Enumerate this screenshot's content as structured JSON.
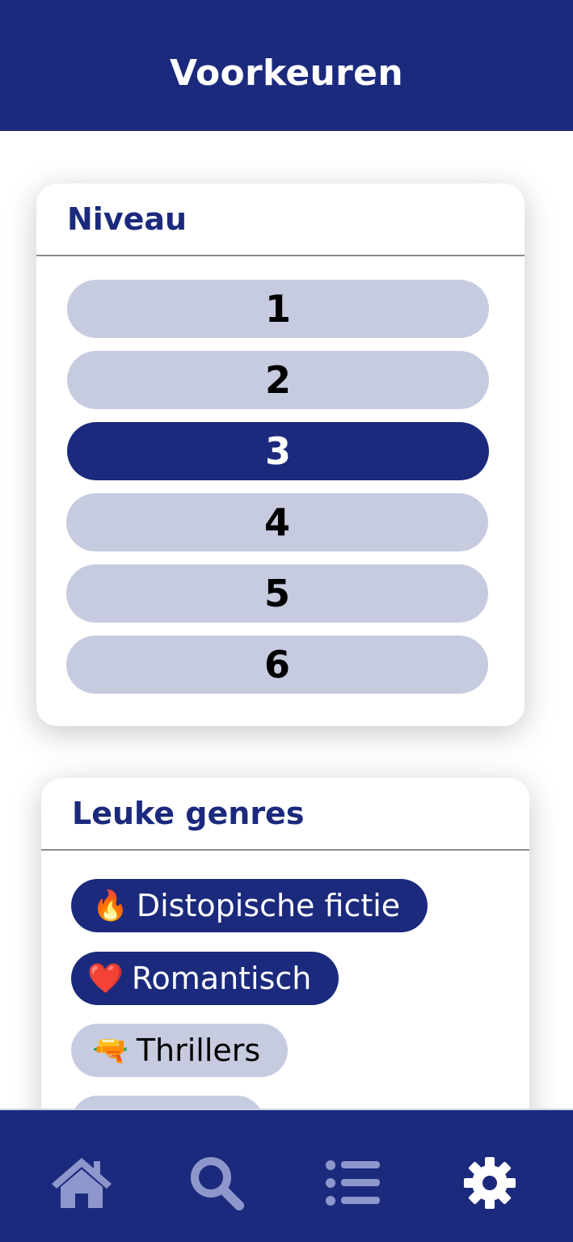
{
  "header": {
    "title": "Voorkeuren"
  },
  "niveau": {
    "title": "Niveau",
    "levels": [
      "1",
      "2",
      "3",
      "4",
      "5",
      "6"
    ],
    "selected": "3"
  },
  "genres": {
    "title": "Leuke genres",
    "items": [
      {
        "emoji": "🔥",
        "label": "Distopische fictie",
        "selected": true
      },
      {
        "emoji": "❤️",
        "label": "Romantisch",
        "selected": true
      },
      {
        "emoji": "🔫",
        "label": "Thrillers",
        "selected": false
      }
    ]
  },
  "bottom_nav": {
    "items": [
      {
        "icon": "home-icon",
        "active": false
      },
      {
        "icon": "search-icon",
        "active": false
      },
      {
        "icon": "list-icon",
        "active": false
      },
      {
        "icon": "gear-icon",
        "active": true
      }
    ]
  },
  "colors": {
    "primary": "#1b2a7c",
    "unselected": "#c6cbe0",
    "inactive_icon": "#8e97cc",
    "active_icon": "#ffffff"
  }
}
